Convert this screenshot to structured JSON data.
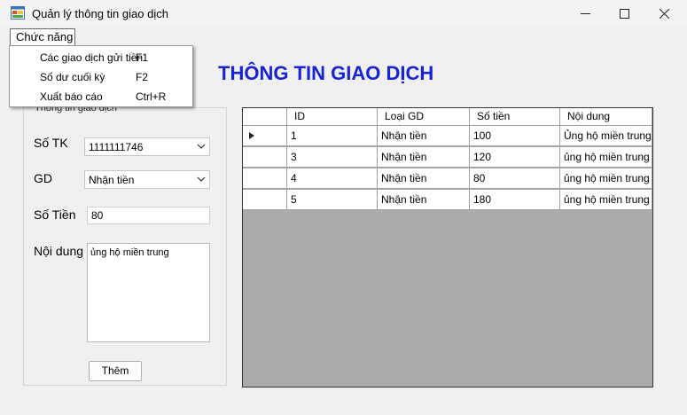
{
  "window": {
    "title": "Quản lý thông tin giao dịch",
    "minimize": "—",
    "maximize": "☐",
    "close": "✕",
    "icon": "form-app-icon"
  },
  "menu": {
    "root_label": "Chức năng",
    "items": [
      {
        "label": "Các giao dịch gửi tiền",
        "shortcut": "F1"
      },
      {
        "label": "Số dư cuối kỳ",
        "shortcut": "F2"
      },
      {
        "label": "Xuất báo cáo",
        "shortcut": "Ctrl+R"
      }
    ]
  },
  "heading": "THÔNG TIN GIAO DỊCH",
  "form": {
    "group_title": "Thông tin giao dịch",
    "account_label": "Số TK",
    "account_value": "1111111746",
    "type_label": "GD",
    "type_value": "Nhận tiền",
    "amount_label": "Số Tiền",
    "amount_value": "80",
    "content_label": "Nội dung",
    "content_value": "ủng hộ miền trung",
    "add_button": "Thêm"
  },
  "grid": {
    "columns": [
      "ID",
      "Loại GD",
      "Số tiền",
      "Nội dung"
    ],
    "rows": [
      {
        "id": "1",
        "type": "Nhận tiền",
        "amount": "100",
        "content": "Ủng hộ miền trung",
        "current": true
      },
      {
        "id": "3",
        "type": "Nhận tiền",
        "amount": "120",
        "content": "ủng hộ miền trung",
        "current": false
      },
      {
        "id": "4",
        "type": "Nhận tiền",
        "amount": "80",
        "content": "ủng hộ miền trung",
        "current": false
      },
      {
        "id": "5",
        "type": "Nhận tiền",
        "amount": "180",
        "content": "ủng hộ miền trung",
        "current": false
      }
    ]
  },
  "colors": {
    "heading": "#1a22d8",
    "grid_background": "#ababab",
    "window_background": "#f0f0f0"
  }
}
